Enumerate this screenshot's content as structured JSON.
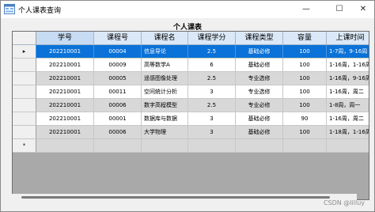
{
  "window": {
    "title": "个人课表查询",
    "minimize": "—",
    "maximize": "☐",
    "close": "✕"
  },
  "caption": "个人课表",
  "grid": {
    "columns": [
      "学号",
      "课程号",
      "课程名",
      "课程学分",
      "课程类型",
      "容量",
      "上课时间"
    ],
    "rows": [
      [
        "202210001",
        "00004",
        "信息导论",
        "2.5",
        "基础必修",
        "100",
        "1-7周，9-16周"
      ],
      [
        "202210001",
        "00009",
        "高等数学A",
        "6",
        "基础必修",
        "100",
        "1-16周，1-16周"
      ],
      [
        "202210001",
        "00005",
        "遥感图像处理",
        "2.5",
        "专业选修",
        "100",
        "1-16周，9-16周"
      ],
      [
        "202210001",
        "00011",
        "空间统计分析",
        "3",
        "专业选修",
        "100",
        "1-16周，周二"
      ],
      [
        "202210001",
        "00006",
        "数字高程模型",
        "2.5",
        "专业必修",
        "100",
        "1-8周，周一"
      ],
      [
        "202210001",
        "00001",
        "数据库与数据",
        "3",
        "基础必修",
        "90",
        "1-16周，周二"
      ],
      [
        "202210001",
        "00006",
        "大学物理",
        "3",
        "基础必修",
        "100",
        "1-18周，1-16周"
      ]
    ],
    "current_row_marker": "▸",
    "new_row_marker": "*"
  },
  "watermark": "CSDN @lilluy"
}
